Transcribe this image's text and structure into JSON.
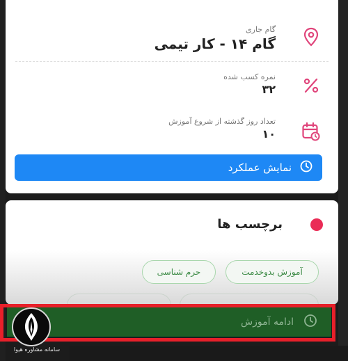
{
  "current_step": {
    "label": "گام جاری",
    "value": "گام ۱۴ - کار تیمی"
  },
  "score": {
    "label": "نمره کسب شده",
    "value": "۳۲"
  },
  "days": {
    "label": "تعداد روز گذشته از شروع آموزش",
    "value": "۱۰"
  },
  "show_performance": {
    "label": "نمایش عملکرد"
  },
  "tags": {
    "title": "برچسب ها",
    "items": [
      "آموزش بدوخدمت",
      "حرم شناسی"
    ]
  },
  "continue_training": {
    "label": "ادامه آموزش"
  },
  "watermark": {
    "text": "سامانه مشاوره هیوا"
  },
  "colors": {
    "accent_blue": "#1e88f5",
    "icon_pink": "#e0457b",
    "tag_dot": "#ea2c56",
    "continue_green": "#1f5e26",
    "highlight_red": "#e8202a"
  },
  "icons": {
    "step": "location-pin-icon",
    "score": "percent-icon",
    "days": "calendar-clock-icon",
    "performance": "clock-icon",
    "continue": "clock-icon"
  }
}
